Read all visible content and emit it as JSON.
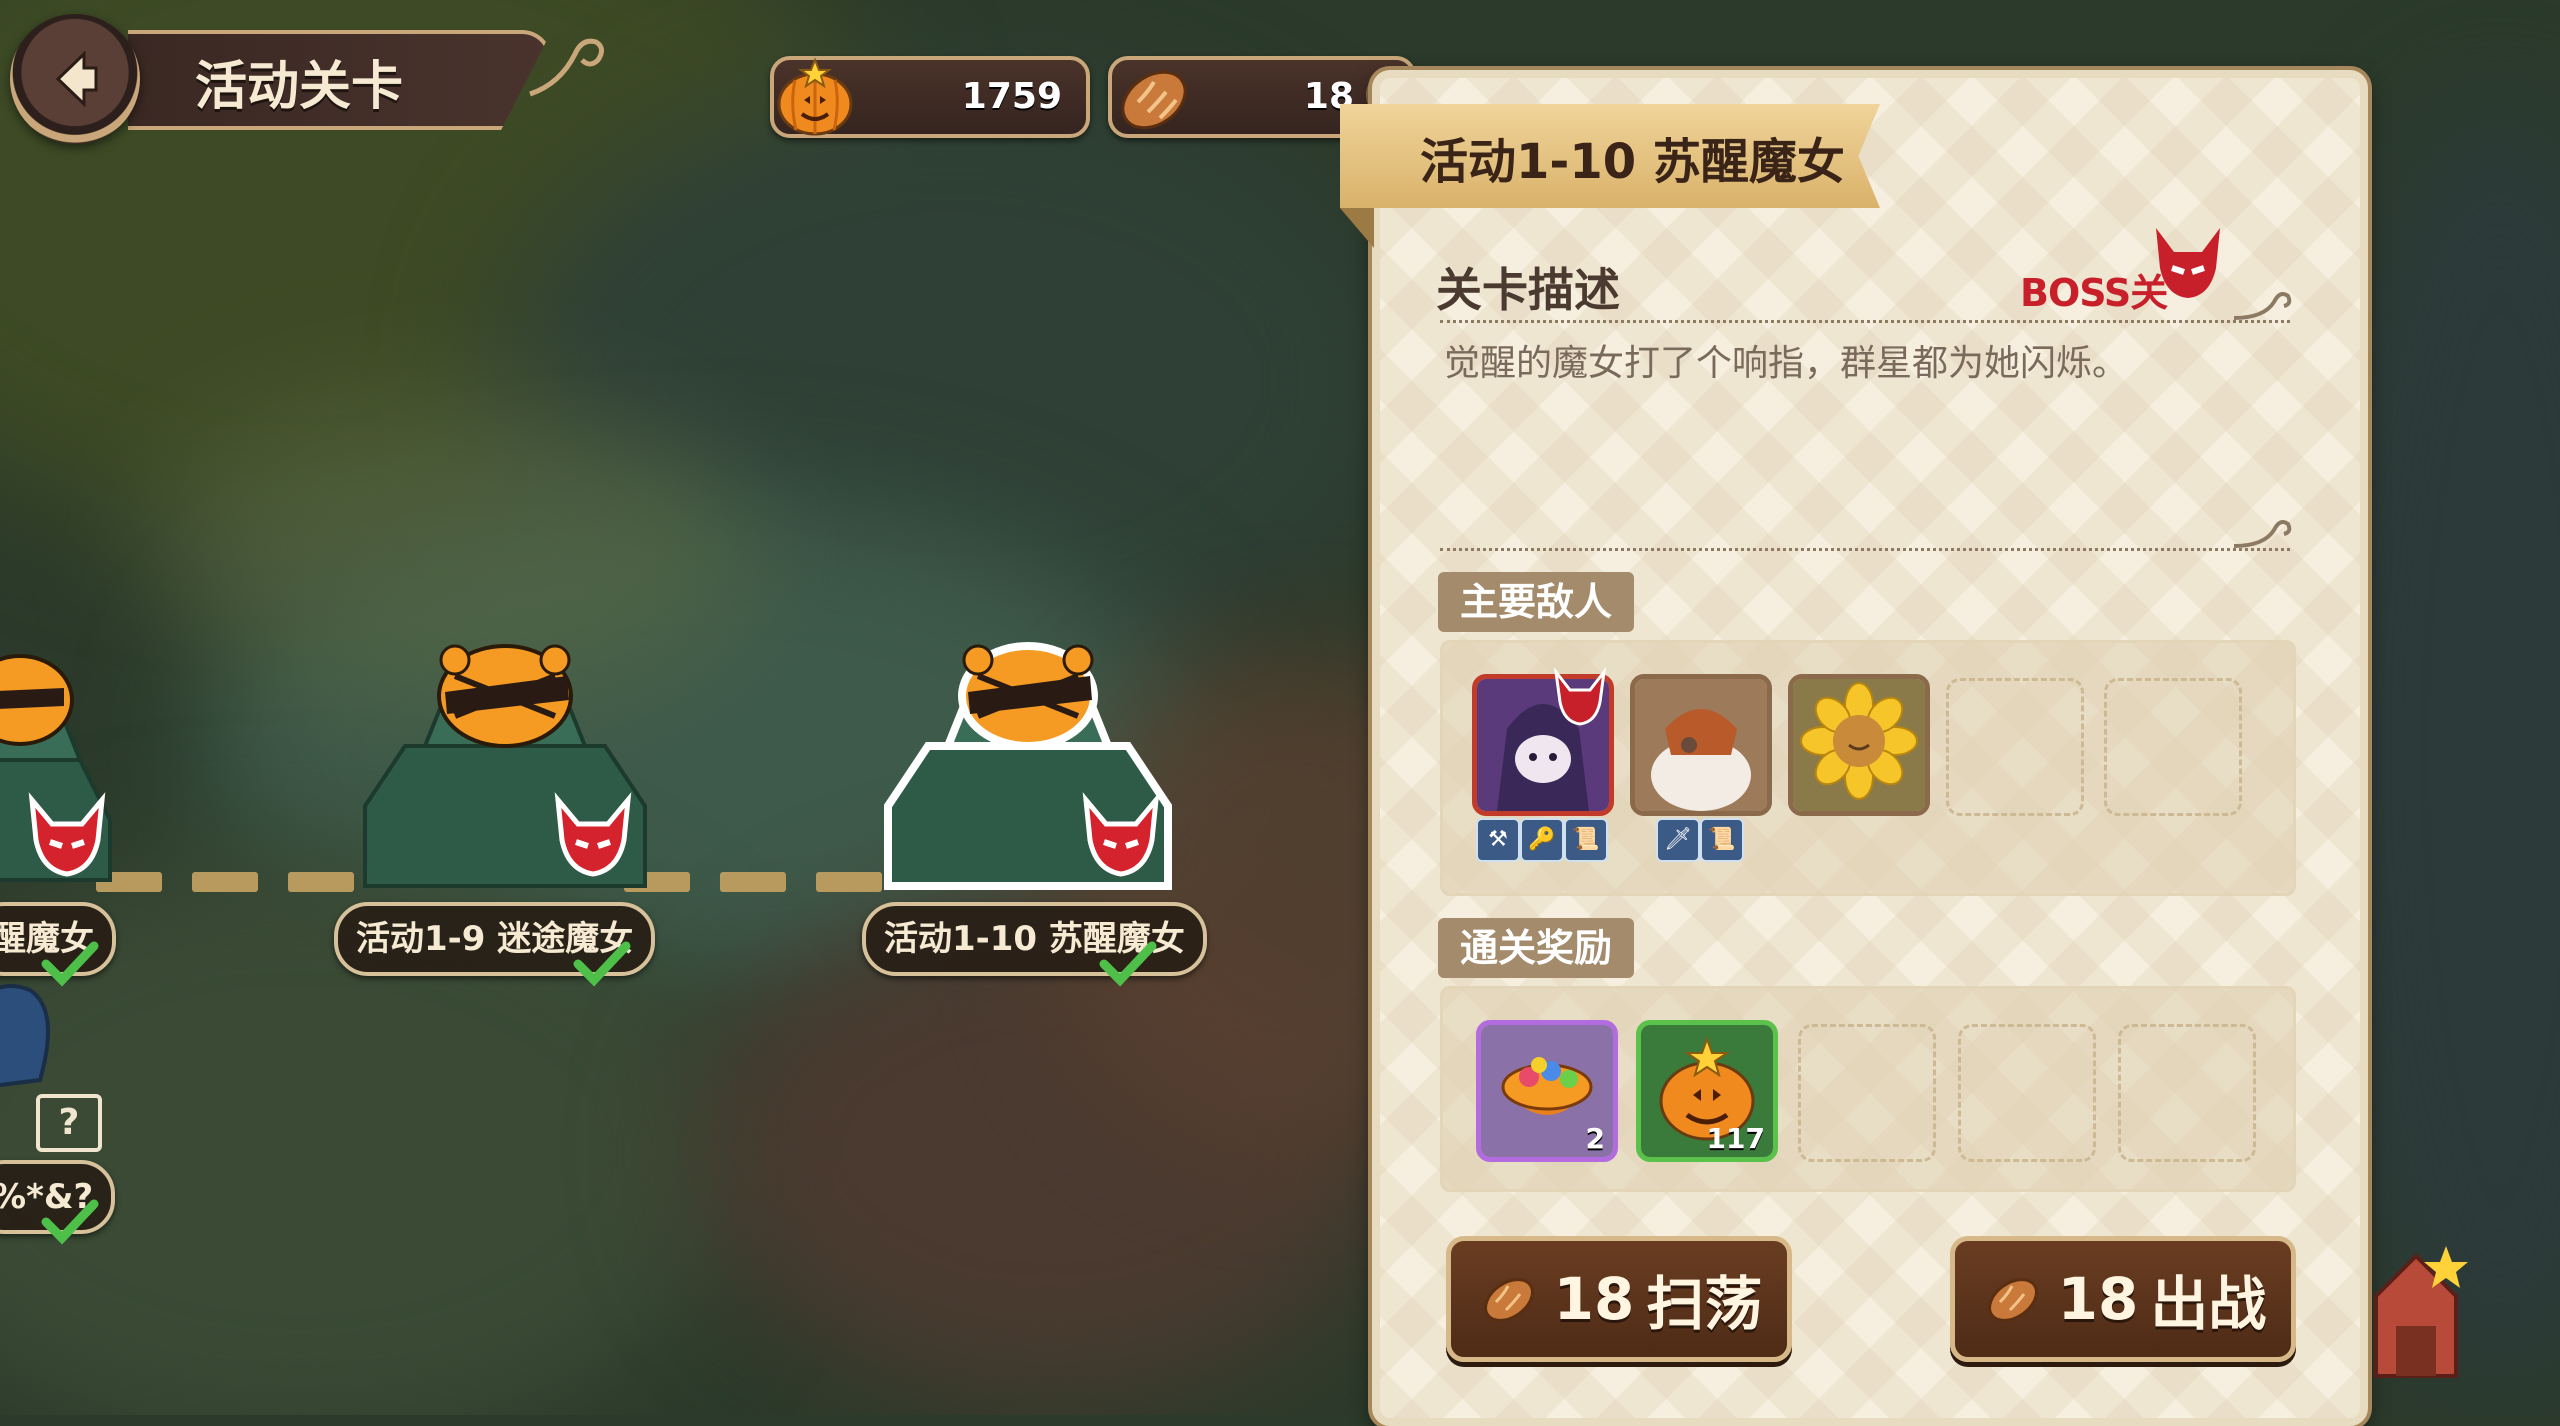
{
  "header": {
    "title": "活动关卡",
    "currencies": [
      {
        "icon": "pumpkin-coin-icon",
        "value": "1759"
      },
      {
        "icon": "bread-stamina-icon",
        "value": "18",
        "add_label": "+"
      }
    ]
  },
  "map": {
    "stages": [
      {
        "label": "醒魔女",
        "status": "cleared",
        "boss": true
      },
      {
        "label": "活动1-9  迷途魔女",
        "status": "cleared",
        "boss": true
      },
      {
        "label": "活动1-10  苏醒魔女",
        "status": "cleared",
        "boss": true,
        "selected": true
      },
      {
        "label": "%*&?",
        "status": "cleared",
        "boss": false,
        "icon": "question-icon"
      }
    ],
    "question_mark": "?"
  },
  "panel": {
    "stage_title": "活动1-10  苏醒魔女",
    "description_heading": "关卡描述",
    "boss_label": "BOSS关",
    "description": "觉醒的魔女打了个响指，群星都为她闪烁。",
    "enemies_heading": "主要敌人",
    "enemies": [
      {
        "name": "hooded-witch",
        "boss": true,
        "traits": [
          "⚒",
          "🔑",
          "📜"
        ]
      },
      {
        "name": "pot-toad",
        "boss": false,
        "traits": [
          "🗡",
          "📜"
        ]
      },
      {
        "name": "sunflower",
        "boss": false,
        "traits": []
      }
    ],
    "enemy_slots": 5,
    "rewards_heading": "通关奖励",
    "rewards": [
      {
        "name": "candy-basket",
        "count": "2",
        "rarity_color": "#b36be0"
      },
      {
        "name": "pumpkin-coin",
        "count": "117",
        "rarity_color": "#5ac24a"
      }
    ],
    "reward_slots": 5,
    "sweep_button": {
      "cost": "18",
      "label": "扫荡"
    },
    "battle_button": {
      "cost": "18",
      "label": "出战"
    }
  },
  "colors": {
    "boss_red": "#c8202a",
    "panel_bg": "#f6efdf",
    "button_brown": "#5a3320"
  }
}
